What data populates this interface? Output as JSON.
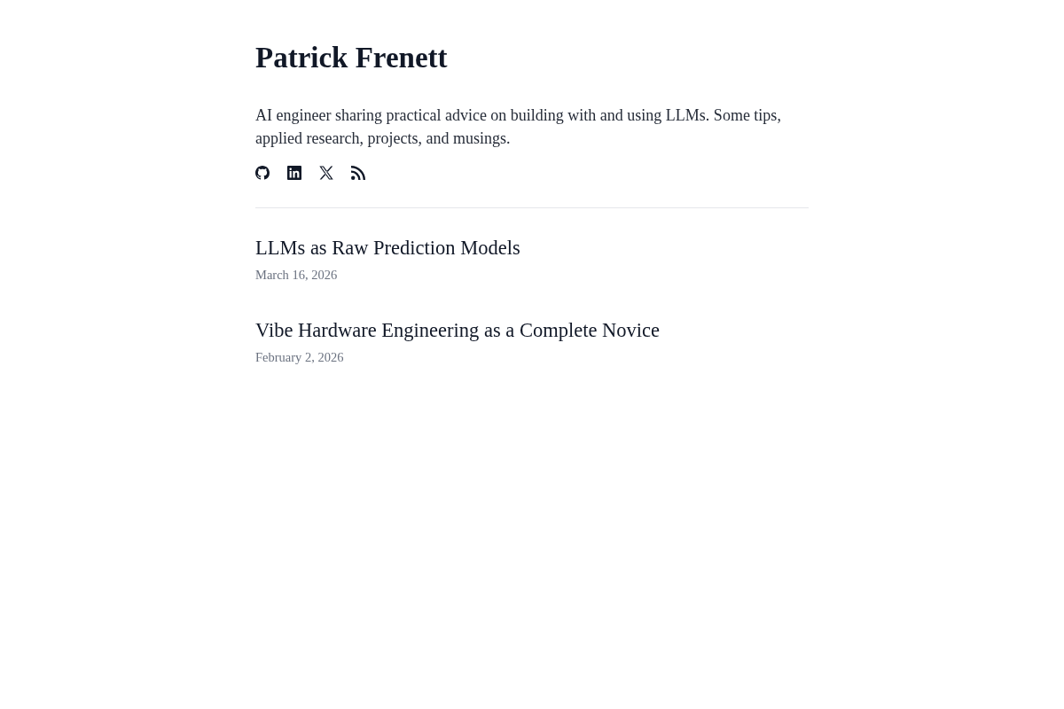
{
  "site": {
    "title": "Patrick Frenett",
    "description": "AI engineer sharing practical advice on building with and using LLMs. Some tips, applied research, projects, and musings."
  },
  "social_links": [
    {
      "kind": "github"
    },
    {
      "kind": "linkedin"
    },
    {
      "kind": "x"
    },
    {
      "kind": "rss"
    }
  ],
  "posts": [
    {
      "title": "LLMs as Raw Prediction Models",
      "date": "March 16, 2026"
    },
    {
      "title": "Vibe Hardware Engineering as a Complete Novice",
      "date": "February 2, 2026"
    }
  ]
}
